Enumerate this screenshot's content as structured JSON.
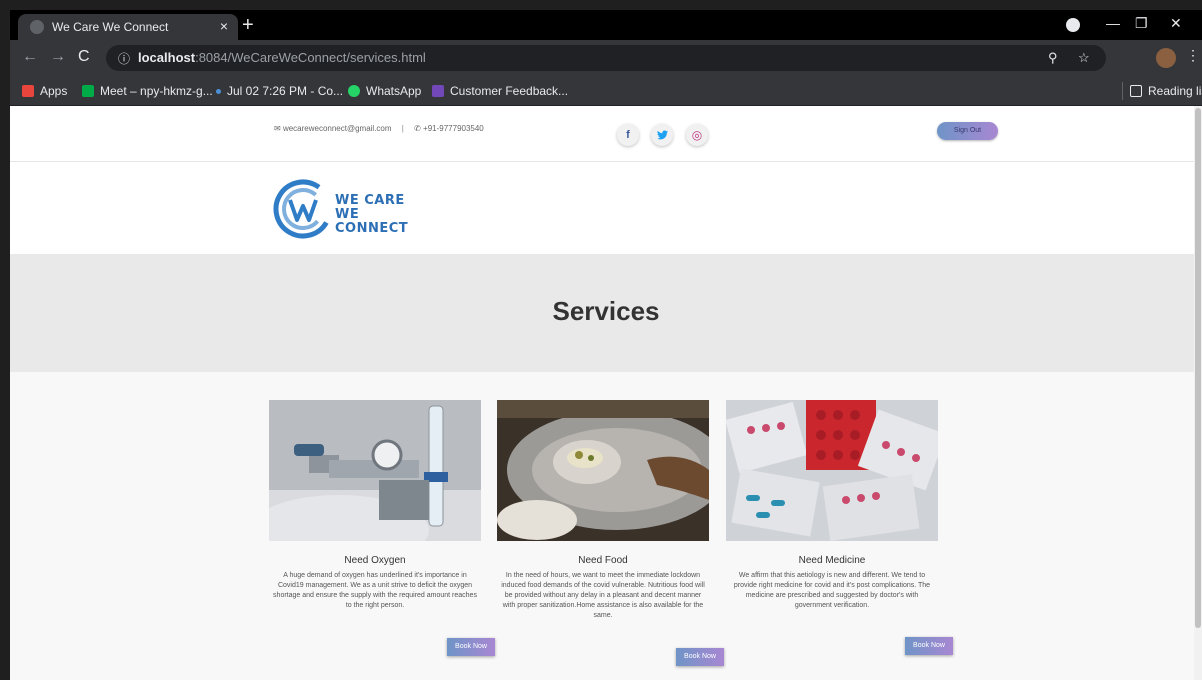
{
  "browser": {
    "tab_title": "We Care We Connect",
    "tab_close": "×",
    "new_tab": "+",
    "url_host": "localhost",
    "url_rest": ":8084/WeCareWeConnect/services.html",
    "bookmarks": [
      {
        "label": "Apps",
        "color": "#e8453c"
      },
      {
        "label": "Meet – npy-hkmz-g...",
        "color": "#00ac47"
      },
      {
        "label": "Jul 02 7:26 PM - Co...",
        "color": "#4a90d9"
      },
      {
        "label": "WhatsApp",
        "color": "#25d366"
      },
      {
        "label": "Customer Feedback...",
        "color": "#7248b9"
      }
    ],
    "reading_list": "Reading list"
  },
  "header": {
    "email": "wecareweconnect@gmail.com",
    "separator": "|",
    "phone": "+91-9777903540",
    "social": [
      {
        "icon": "facebook-icon",
        "glyph": "f"
      },
      {
        "icon": "twitter-icon",
        "glyph": "🐦"
      },
      {
        "icon": "instagram-icon",
        "glyph": "◎"
      }
    ],
    "sign_out": "Sign Out"
  },
  "logo": {
    "line1": "WE CARE",
    "line2": "WE CONNECT"
  },
  "hero": {
    "title": "Services"
  },
  "services": [
    {
      "title": "Need Oxygen",
      "description": "A huge demand of oxygen has underlined it's importance in Covid19 management. We as a unit strive to deficit the oxygen shortage and ensure the supply with the required amount reaches to the right person.",
      "button": "Book Now"
    },
    {
      "title": "Need Food",
      "description": "In the need of hours, we want to meet the immediate lockdown induced food demands of the covid vulnerable. Nutritious food will be provided without any delay in a pleasant and decent manner with proper sanitization.Home assistance is also available for the same.",
      "button": "Book Now"
    },
    {
      "title": "Need Medicine",
      "description": "We affirm that this aetiology is new and different. We tend to provide right medicine for covid and it's post complications. The medicine are prescribed and suggested by doctor's with government verification.",
      "button": "Book Now"
    }
  ]
}
